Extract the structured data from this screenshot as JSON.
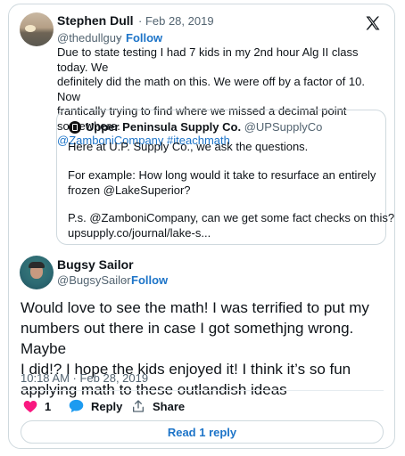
{
  "tweet": {
    "author_name": "Stephen Dull",
    "date": "· Feb 28, 2019",
    "handle": "@thedullguy",
    "separator": "·",
    "follow_label": "Follow",
    "lines": [
      "Due to state testing I had 7 kids in my 2nd hour Alg II class today. We",
      "definitely did the math on this. We were off by a factor of 10. Now",
      "frantically trying to find where we missed a decimal point somewhere."
    ],
    "mention": "@ZamboniCompany",
    "hashtag": "#iteachmath"
  },
  "quoted": {
    "author_name": "Upper Peninsula Supply Co.",
    "handle": "@UPSupplyCo",
    "line1": "Here at U.P. Supply Co., we ask the questions.",
    "line2": "For example: How long would it take to resurface an entirely",
    "line3": "frozen @LakeSuperior?",
    "line4": "P.s. @ZamboniCompany, can we get some fact checks on this?",
    "line5": "upsupply.co/journal/lake-s..."
  },
  "reply": {
    "author_name": "Bugsy Sailor",
    "handle": "@BugsySailor",
    "separator": "·",
    "follow_label": "Follow",
    "lines": [
      "Would love to see the math! I was terrified to put my",
      "numbers out there in case I got somethjng wrong. Maybe",
      "I did!? I hope the kids enjoyed it! I think it’s so fun",
      "applying math to these outlandish ideas"
    ],
    "timestamp": "10:18 AM · Feb 28, 2019",
    "like_count": "1",
    "reply_label": "Reply",
    "share_label": "Share",
    "read_replies_label": "Read 1 reply"
  },
  "icons": {
    "x_logo": "x-logo-icon",
    "like": "heart-icon",
    "reply": "speech-bubble-icon",
    "share": "share-icon"
  },
  "colors": {
    "accent": "#1d74c8",
    "heart": "#f91880",
    "border": "#cfd9de",
    "muted": "#536471"
  }
}
